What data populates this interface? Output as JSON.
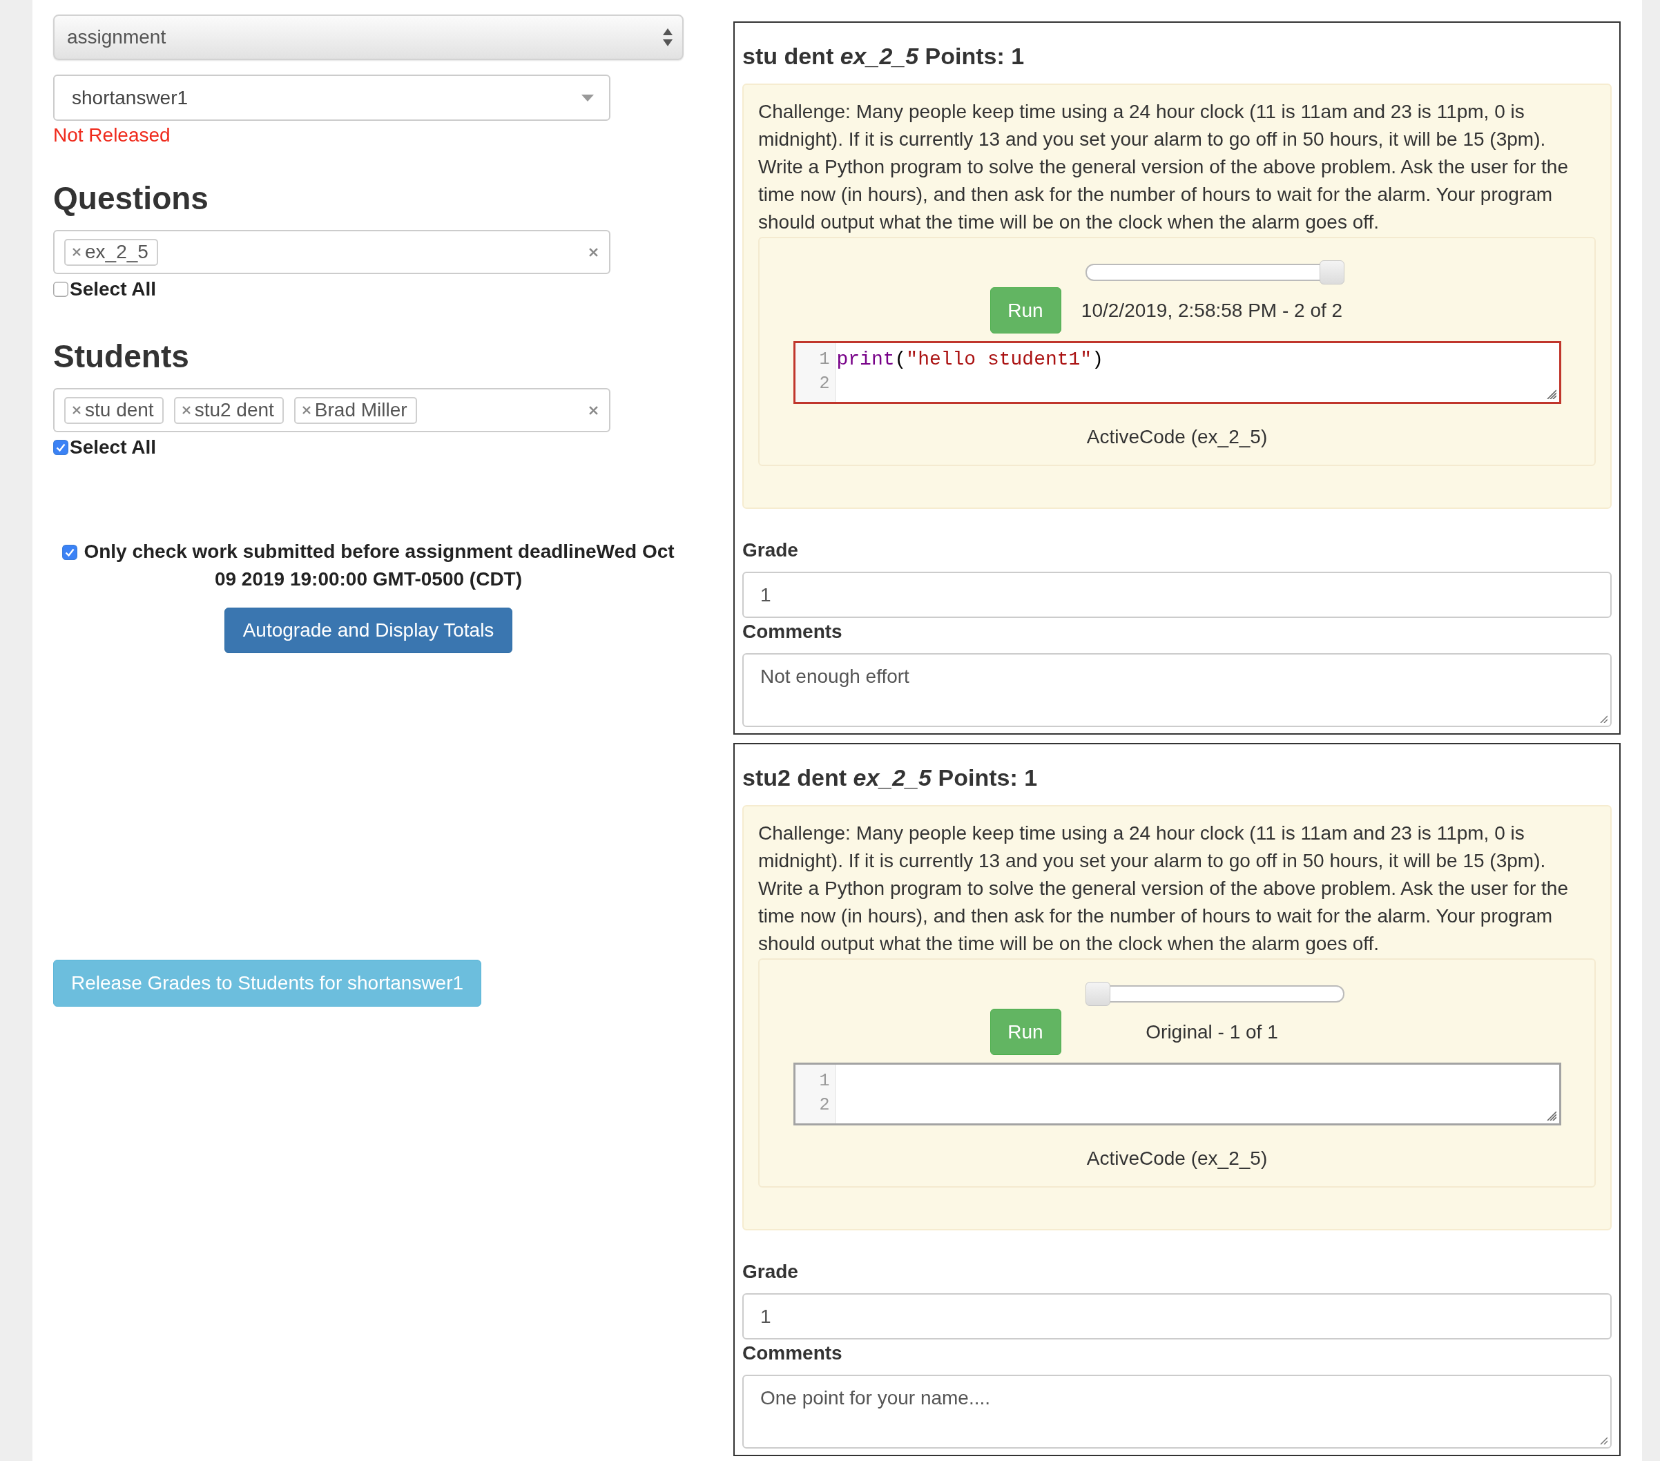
{
  "assignment_select": {
    "value": "assignment"
  },
  "problem_select": {
    "value": "shortanswer1"
  },
  "release_status": "Not Released",
  "questions": {
    "heading": "Questions",
    "tags": [
      "ex_2_5"
    ],
    "select_all": {
      "label": "Select All",
      "checked": false
    }
  },
  "students": {
    "heading": "Students",
    "tags": [
      "stu dent",
      "stu2 dent",
      "Brad Miller"
    ],
    "select_all": {
      "label": "Select All",
      "checked": true
    }
  },
  "deadline_option": {
    "label": "Only check work submitted before assignment deadlineWed Oct 09 2019 19:00:00 GMT-0500 (CDT)",
    "checked": true
  },
  "autograde_button": "Autograde and Display Totals",
  "release_button": "Release Grades to Students for shortanswer1",
  "submissions": [
    {
      "heading": "stu dent *ex_2_5* Points: 1",
      "prompt": [
        "Challenge: Many people keep time using a 24 hour clock (11 is 11am and 23 is 11pm, 0 is midnight). If it is currently 13 and you set your alarm to go off in 50 hours, it will be 15 (3pm).",
        "Write a Python program to solve the general version of the above problem. Ask the user for the time now (in hours), and then ask for the number of hours to wait for the alarm. Your program should output what the time will be on the clock when the alarm goes off."
      ],
      "history": {
        "level": 1,
        "label": "10/2/2019, 2:58:58 PM - 2 of 2"
      },
      "run_button": "Run",
      "editor": {
        "highlighted": true,
        "line_numbers": [
          "1",
          "2"
        ],
        "tokens": [
          {
            "kind": "builtin",
            "text": "print"
          },
          {
            "kind": "punct",
            "text": "("
          },
          {
            "kind": "string",
            "text": "\"hello student1\""
          },
          {
            "kind": "punct",
            "text": ")"
          }
        ]
      },
      "caption": "ActiveCode (ex_2_5)",
      "grade": {
        "label": "Grade",
        "value": "1"
      },
      "comments": {
        "label": "Comments",
        "value": "Not enough effort"
      }
    },
    {
      "heading": "stu2 dent *ex_2_5* Points: 1",
      "prompt": [
        "Challenge: Many people keep time using a 24 hour clock (11 is 11am and 23 is 11pm, 0 is midnight). If it is currently 13 and you set your alarm to go off in 50 hours, it will be 15 (3pm).",
        "Write a Python program to solve the general version of the above problem. Ask the user for the time now (in hours), and then ask for the number of hours to wait for the alarm. Your program should output what the time will be on the clock when the alarm goes off."
      ],
      "history": {
        "level": 0,
        "label": "Original - 1 of 1"
      },
      "run_button": "Run",
      "editor": {
        "highlighted": false,
        "line_numbers": [
          "1",
          "2"
        ]
      },
      "caption": "ActiveCode (ex_2_5)",
      "grade": {
        "label": "Grade",
        "value": "1"
      },
      "comments": {
        "label": "Comments",
        "value": "One point for your name...."
      }
    }
  ]
}
